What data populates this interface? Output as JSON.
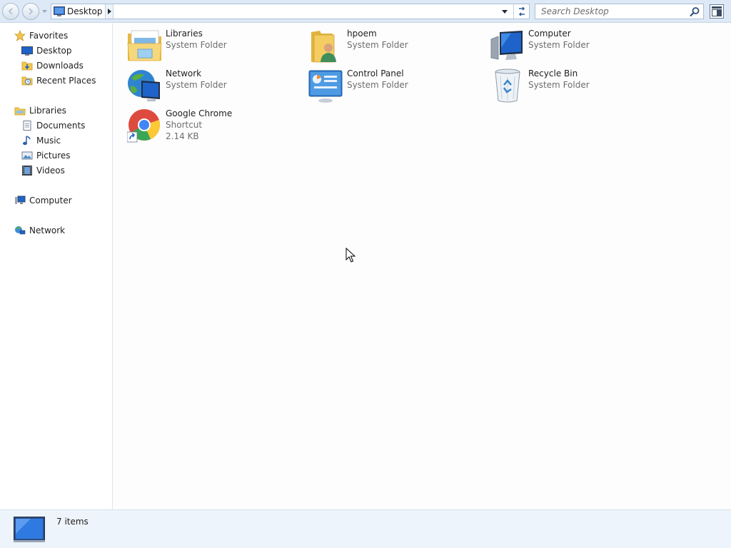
{
  "toolbar": {
    "address": {
      "crumb": "Desktop"
    },
    "search": {
      "placeholder": "Search Desktop"
    }
  },
  "sidebar": {
    "favorites": {
      "label": "Favorites",
      "items": [
        {
          "label": "Desktop"
        },
        {
          "label": "Downloads"
        },
        {
          "label": "Recent Places"
        }
      ]
    },
    "libraries": {
      "label": "Libraries",
      "items": [
        {
          "label": "Documents"
        },
        {
          "label": "Music"
        },
        {
          "label": "Pictures"
        },
        {
          "label": "Videos"
        }
      ]
    },
    "computer": {
      "label": "Computer"
    },
    "network": {
      "label": "Network"
    }
  },
  "items": [
    {
      "name": "Libraries",
      "type": "System Folder",
      "icon": "libraries-icon"
    },
    {
      "name": "hpoem",
      "type": "System Folder",
      "icon": "user-folder-icon"
    },
    {
      "name": "Computer",
      "type": "System Folder",
      "icon": "computer-icon"
    },
    {
      "name": "Network",
      "type": "System Folder",
      "icon": "network-icon"
    },
    {
      "name": "Control Panel",
      "type": "System Folder",
      "icon": "control-panel-icon"
    },
    {
      "name": "Recycle Bin",
      "type": "System Folder",
      "icon": "recycle-bin-icon"
    },
    {
      "name": "Google Chrome",
      "type": "Shortcut",
      "size": "2.14 KB",
      "icon": "chrome-icon"
    }
  ],
  "status": {
    "count": "7 items"
  },
  "colors": {
    "chrome_bar": "#dde9f6",
    "status_bar": "#eef4fb",
    "folder_yellow": "#f3c94d",
    "screen_blue": "#1e63c9"
  }
}
